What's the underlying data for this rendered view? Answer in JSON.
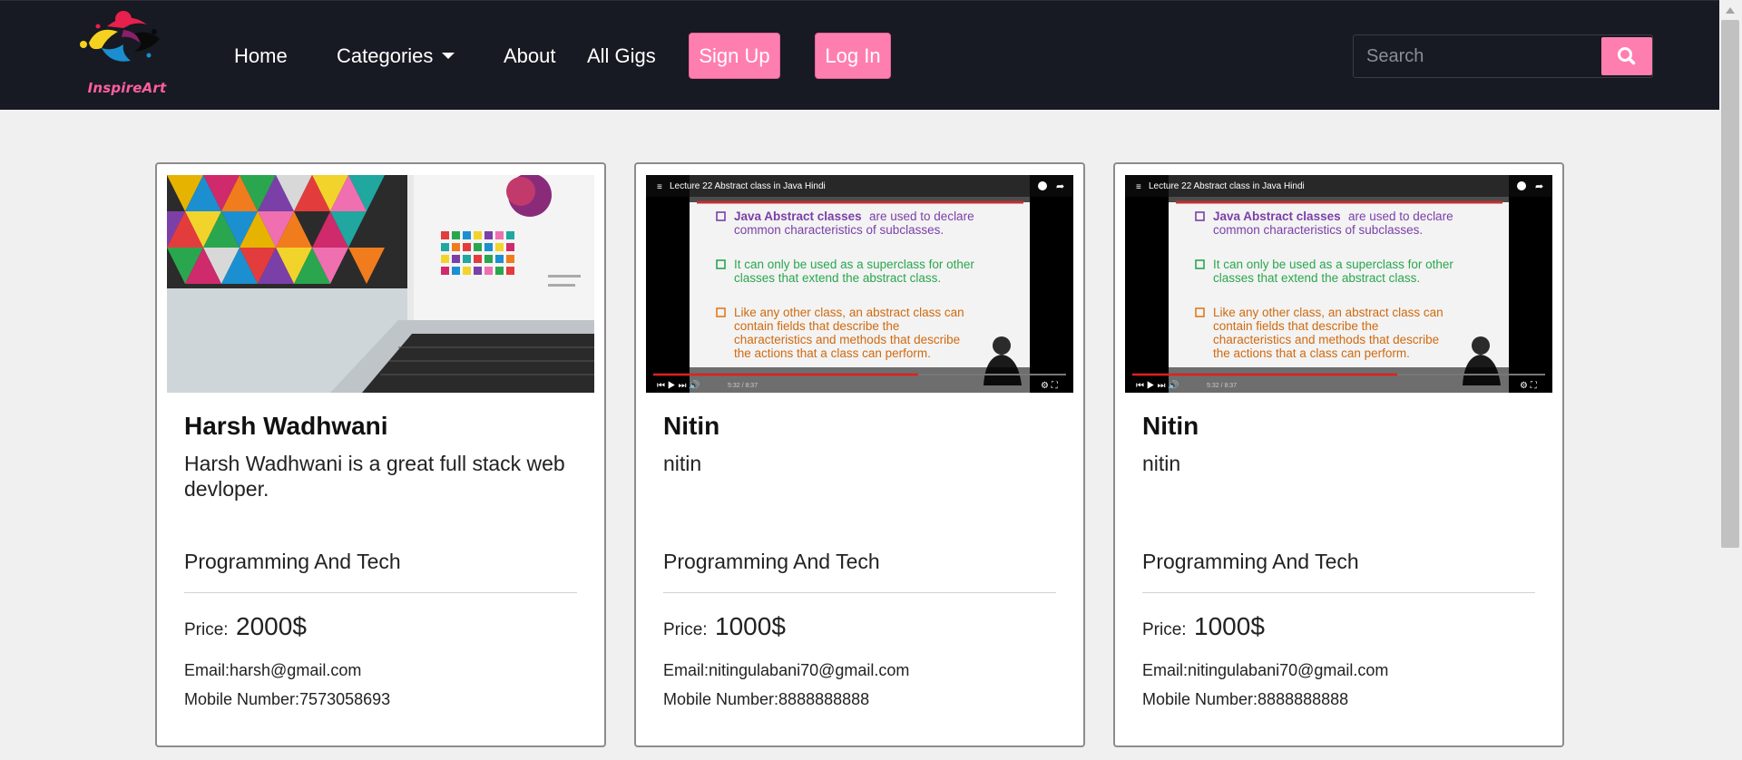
{
  "brand": {
    "name": "InspireArt"
  },
  "nav": {
    "home": "Home",
    "categories": "Categories",
    "about": "About",
    "all_gigs": "All Gigs",
    "signup": "Sign Up",
    "login": "Log In"
  },
  "search": {
    "placeholder": "Search",
    "icon": "search-icon"
  },
  "video": {
    "title": "Lecture 22 Abstract class in Java Hindi",
    "bullet1_bold": "Java Abstract classes",
    "bullet1_rest": " are used to declare",
    "bullet1_line2": "common characteristics of subclasses.",
    "bullet2_line1": "It can only be used as a superclass for other",
    "bullet2_line2": "classes that extend the abstract class.",
    "bullet3_line1": "Like any other class, an abstract class can",
    "bullet3_line2": "contain fields that describe the",
    "bullet3_line3": "characteristics and methods that describe",
    "bullet3_line4": "the actions that a class can perform.",
    "time": "5:32 / 8:37"
  },
  "cards": [
    {
      "image": "laptop-photo",
      "name": "Harsh Wadhwani",
      "description": "Harsh Wadhwani is a great full stack web devloper.",
      "category": "Programming And Tech",
      "price_label": "Price:",
      "price": "2000$",
      "email": "Email:harsh@gmail.com",
      "mobile": "Mobile Number:7573058693"
    },
    {
      "image": "video-thumbnail",
      "name": "Nitin",
      "description": "nitin",
      "category": "Programming And Tech",
      "price_label": "Price:",
      "price": "1000$",
      "email": "Email:nitingulabani70@gmail.com",
      "mobile": "Mobile Number:8888888888"
    },
    {
      "image": "video-thumbnail",
      "name": "Nitin",
      "description": "nitin",
      "category": "Programming And Tech",
      "price_label": "Price:",
      "price": "1000$",
      "email": "Email:nitingulabani70@gmail.com",
      "mobile": "Mobile Number:8888888888"
    }
  ],
  "colors": {
    "navbar": "#171a22",
    "accent": "#ff7eb0",
    "page_bg": "#f0f0f0"
  }
}
